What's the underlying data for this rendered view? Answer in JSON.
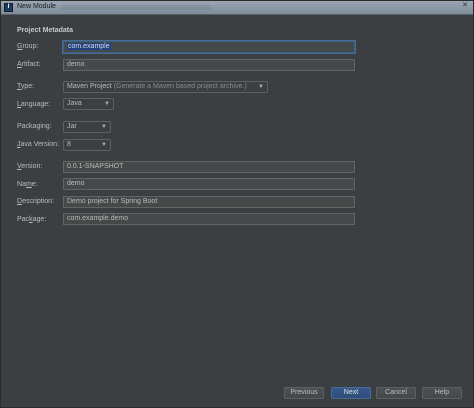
{
  "window": {
    "title": "New Module"
  },
  "section_title": "Project Metadata",
  "fields": {
    "group": {
      "label_u": "G",
      "label_rest": "roup:",
      "value": "com.example"
    },
    "artifact": {
      "label_u": "A",
      "label_rest": "rtifact:",
      "value": "demo"
    },
    "type": {
      "label_u": "T",
      "label_rest": "ype:",
      "value": "Maven Project",
      "hint": "(Generate a Maven based project archive.)"
    },
    "language": {
      "label_u": "L",
      "label_rest": "anguage:",
      "value": "Java"
    },
    "packaging": {
      "label_u": "",
      "label_rest": "Packaging:",
      "value": "Jar"
    },
    "java_version": {
      "label_u": "J",
      "label_rest": "ava Version:",
      "value": "8"
    },
    "version": {
      "label_u": "V",
      "label_rest": "ersion:",
      "value": "0.0.1-SNAPSHOT"
    },
    "name": {
      "label_pre": "Na",
      "label_u": "m",
      "label_rest": "e:",
      "value": "demo"
    },
    "description": {
      "label_u": "D",
      "label_rest": "escription:",
      "value": "Demo project for Spring Boot"
    },
    "package": {
      "label_pre": "Pac",
      "label_u": "k",
      "label_rest": "age:",
      "value": "com.example.demo"
    }
  },
  "buttons": {
    "previous": "Previous",
    "next": "Next",
    "cancel": "Cancel",
    "help": "Help"
  },
  "icons": {
    "app": "intellij-icon",
    "dropdown": "chevron-down-icon"
  },
  "colors": {
    "background": "#3c3f41",
    "accent": "#214283",
    "primary_button": "#36598b"
  }
}
